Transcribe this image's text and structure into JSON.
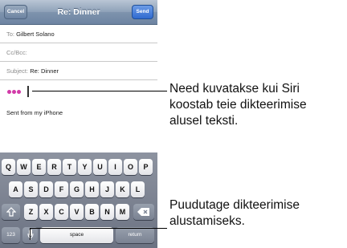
{
  "navbar": {
    "cancel_label": "Cancel",
    "title": "Re: Dinner",
    "send_label": "Send"
  },
  "fields": {
    "to_label": "To:",
    "to_value": "Gilbert Solano",
    "cc_label": "Cc/Bcc:",
    "subject_label": "Subject:",
    "subject_value": "Re: Dinner"
  },
  "body": {
    "signature": "Sent from my iPhone",
    "dictation_dot_color": "#d23aa8"
  },
  "keyboard": {
    "row1": [
      "Q",
      "W",
      "E",
      "R",
      "T",
      "Y",
      "U",
      "I",
      "O",
      "P"
    ],
    "row2": [
      "A",
      "S",
      "D",
      "F",
      "G",
      "H",
      "J",
      "K",
      "L"
    ],
    "row3": [
      "Z",
      "X",
      "C",
      "V",
      "B",
      "N",
      "M"
    ],
    "shift_icon": "shift-icon",
    "delete_icon": "delete-icon",
    "numbers_label": "123",
    "mic_icon": "microphone-icon",
    "space_label": "space",
    "return_label": "return"
  },
  "callouts": {
    "dictation_line1": "Need kuvatakse kui Siri",
    "dictation_line2": "koostab teie dikteerimise",
    "dictation_line3": "alusel teksti.",
    "mic_line1": "Puudutage dikteerimise",
    "mic_line2": "alustamiseks."
  }
}
